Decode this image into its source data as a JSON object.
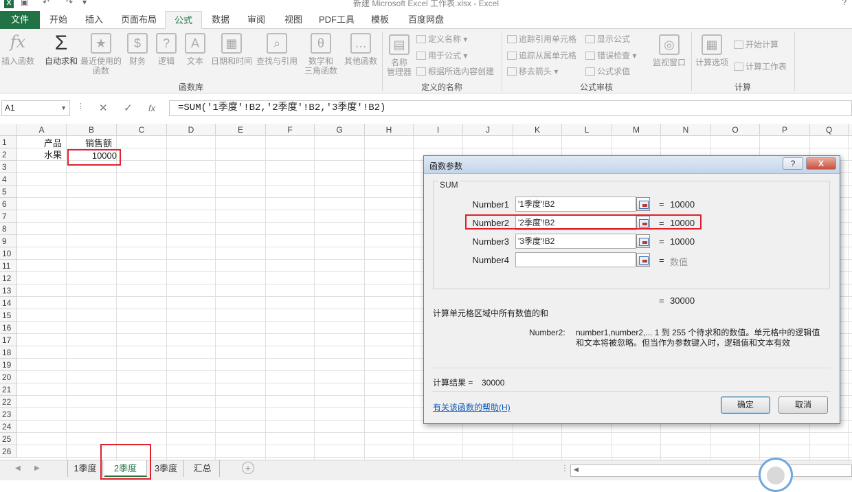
{
  "window": {
    "title": "新建 Microsoft Excel 工作表.xlsx - Excel",
    "help": "?"
  },
  "tabs": [
    {
      "label": "文件"
    },
    {
      "label": "开始"
    },
    {
      "label": "插入"
    },
    {
      "label": "页面布局"
    },
    {
      "label": "公式"
    },
    {
      "label": "数据"
    },
    {
      "label": "审阅"
    },
    {
      "label": "视图"
    },
    {
      "label": "PDF工具"
    },
    {
      "label": "模板"
    },
    {
      "label": "百度网盘"
    }
  ],
  "ribbon": {
    "insert_function": "插入函数",
    "autosum": "自动求和",
    "recent": "最近使用的\n函数",
    "recent_1": "最近使用的",
    "recent_2": "函数",
    "financial": "财务",
    "logical": "逻辑",
    "text": "文本",
    "datetime": "日期和时间",
    "lookup": "查找与引用",
    "math_1": "数学和",
    "math_2": "三角函数",
    "other": "其他函数",
    "group_library": "函数库",
    "name_mgr_1": "名称",
    "name_mgr_2": "管理器",
    "define_name": "定义名称",
    "use_in_formula": "用于公式",
    "create_from_sel": "根据所选内容创建",
    "group_names": "定义的名称",
    "trace_precedents": "追踪引用单元格",
    "trace_dependents": "追踪从属单元格",
    "remove_arrows": "移去箭头",
    "show_formulas": "显示公式",
    "error_check": "错误检查",
    "evaluate": "公式求值",
    "group_audit": "公式审核",
    "watch_window": "监视窗口",
    "calc_options": "计算选项",
    "calc_now": "开始计算",
    "calc_sheet": "计算工作表",
    "group_calc": "计算"
  },
  "formula_bar": {
    "name_box": "A1",
    "formula": "=SUM('1季度'!B2,'2季度'!B2,'3季度'!B2)"
  },
  "columns": [
    "A",
    "B",
    "C",
    "D",
    "E",
    "F",
    "G",
    "H",
    "I",
    "J",
    "K",
    "L",
    "M",
    "N",
    "O",
    "P",
    "Q"
  ],
  "rows": [
    "1",
    "2",
    "3",
    "4",
    "5",
    "6",
    "7",
    "8",
    "9",
    "10",
    "11",
    "12",
    "13",
    "14",
    "15",
    "16",
    "17",
    "18",
    "19",
    "20",
    "21",
    "22",
    "23",
    "24",
    "25",
    "26"
  ],
  "cells": {
    "A1": "产品",
    "B1": "销售额",
    "A2": "水果",
    "B2": "10000"
  },
  "sheet_tabs": [
    {
      "label": "1季度"
    },
    {
      "label": "2季度"
    },
    {
      "label": "3季度"
    },
    {
      "label": "汇总"
    }
  ],
  "dialog": {
    "title": "函数参数",
    "func": "SUM",
    "args": [
      {
        "label": "Number1",
        "value": "'1季度'!B2",
        "result": "10000"
      },
      {
        "label": "Number2",
        "value": "'2季度'!B2",
        "result": "10000"
      },
      {
        "label": "Number3",
        "value": "'3季度'!B2",
        "result": "10000"
      },
      {
        "label": "Number4",
        "value": "",
        "result": "数值"
      }
    ],
    "eq": "=",
    "total": "30000",
    "description": "计算单元格区域中所有数值的和",
    "arg_name": "Number2:",
    "arg_desc_1": "number1,number2,...  1 到 255 个待求和的数值。单元格中的逻辑值",
    "arg_desc_2": "和文本将被忽略。但当作为参数键入时，逻辑值和文本有效",
    "calc_result_label": "计算结果 =",
    "calc_result": "30000",
    "help_link": "有关该函数的帮助(H)",
    "ok": "确定",
    "cancel": "取消",
    "help_btn": "?",
    "close_btn": "X"
  },
  "colors": {
    "accent": "#217346",
    "highlight": "#e0202a",
    "link": "#0b57b8"
  },
  "icons": [
    "excel-logo-icon",
    "save-icon",
    "undo-icon",
    "redo-icon",
    "fx-icon",
    "sigma-icon",
    "cancel-x-icon",
    "check-icon",
    "ref-collapse-icon"
  ]
}
